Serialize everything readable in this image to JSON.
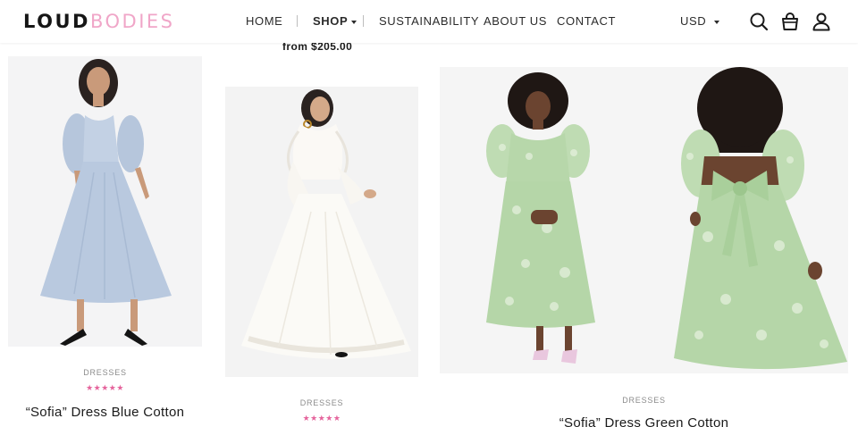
{
  "brand": {
    "part1": "LOUD",
    "part2": "BODIES"
  },
  "nav": {
    "items": [
      {
        "label": "HOME"
      },
      {
        "label": "SHOP"
      },
      {
        "label": "SUSTAINABILITY"
      },
      {
        "label": "ABOUT US"
      },
      {
        "label": "CONTACT"
      }
    ],
    "currency": "USD"
  },
  "icons": [
    "search-icon",
    "bag-icon",
    "account-icon"
  ],
  "colors": {
    "brand_pink": "#f0a6c8",
    "star_pink": "#e5649c",
    "text_dark": "#1a1a1a"
  },
  "products": [
    {
      "category": "DRESSES",
      "rating": "★★★★★",
      "name": "“Sofia” Dress Blue Cotton"
    },
    {
      "category": "DRESSES",
      "rating": "★★★★★",
      "price": "from $205.00"
    },
    {
      "category": "DRESSES",
      "name": "“Sofia” Dress Green Cotton"
    }
  ]
}
